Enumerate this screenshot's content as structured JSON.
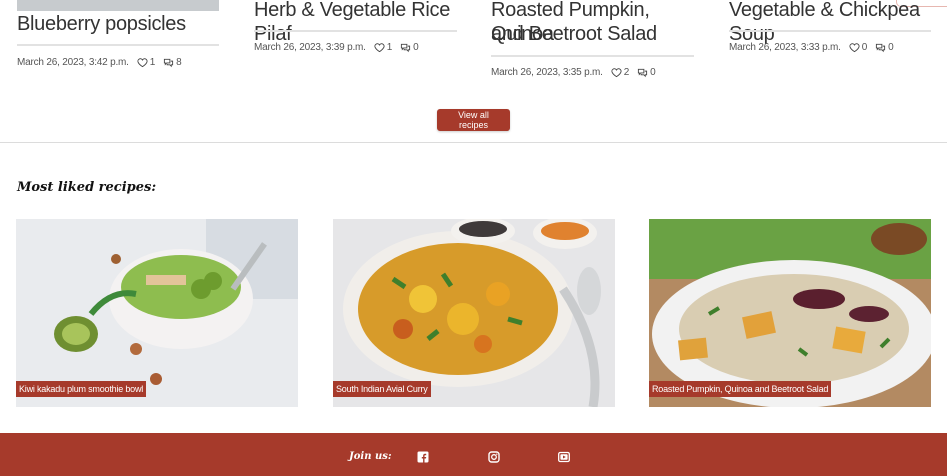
{
  "recent": [
    {
      "title": "Blueberry popsicles",
      "date": "March 26, 2023, 3:42 p.m.",
      "likes": "1",
      "comments": "8"
    },
    {
      "title": "Herb & Vegetable Rice Pilaf",
      "date": "March 26, 2023, 3:39 p.m.",
      "likes": "1",
      "comments": "0"
    },
    {
      "title_line1": "Roasted Pumpkin, Quinoa",
      "title_line2": "and Beetroot Salad",
      "date": "March 26, 2023, 3:35 p.m.",
      "likes": "2",
      "comments": "0"
    },
    {
      "title": "Vegetable & Chickpea Soup",
      "date": "March 26, 2023, 3:33 p.m.",
      "likes": "0",
      "comments": "0"
    }
  ],
  "view_all_label": "View all recipes",
  "most_liked_title": "Most liked recipes:",
  "most_liked": [
    {
      "label": "Kiwi kakadu plum smoothie bowl"
    },
    {
      "label": "South Indian Avial Curry"
    },
    {
      "label": "Roasted Pumpkin, Quinoa and Beetroot Salad"
    }
  ],
  "footer": {
    "join_label": "Join us:"
  },
  "colors": {
    "accent": "#a63a2b"
  },
  "icons": {
    "likes": "heart-icon",
    "comments": "comments-icon",
    "social": [
      "facebook-icon",
      "instagram-icon",
      "youtube-icon"
    ]
  }
}
